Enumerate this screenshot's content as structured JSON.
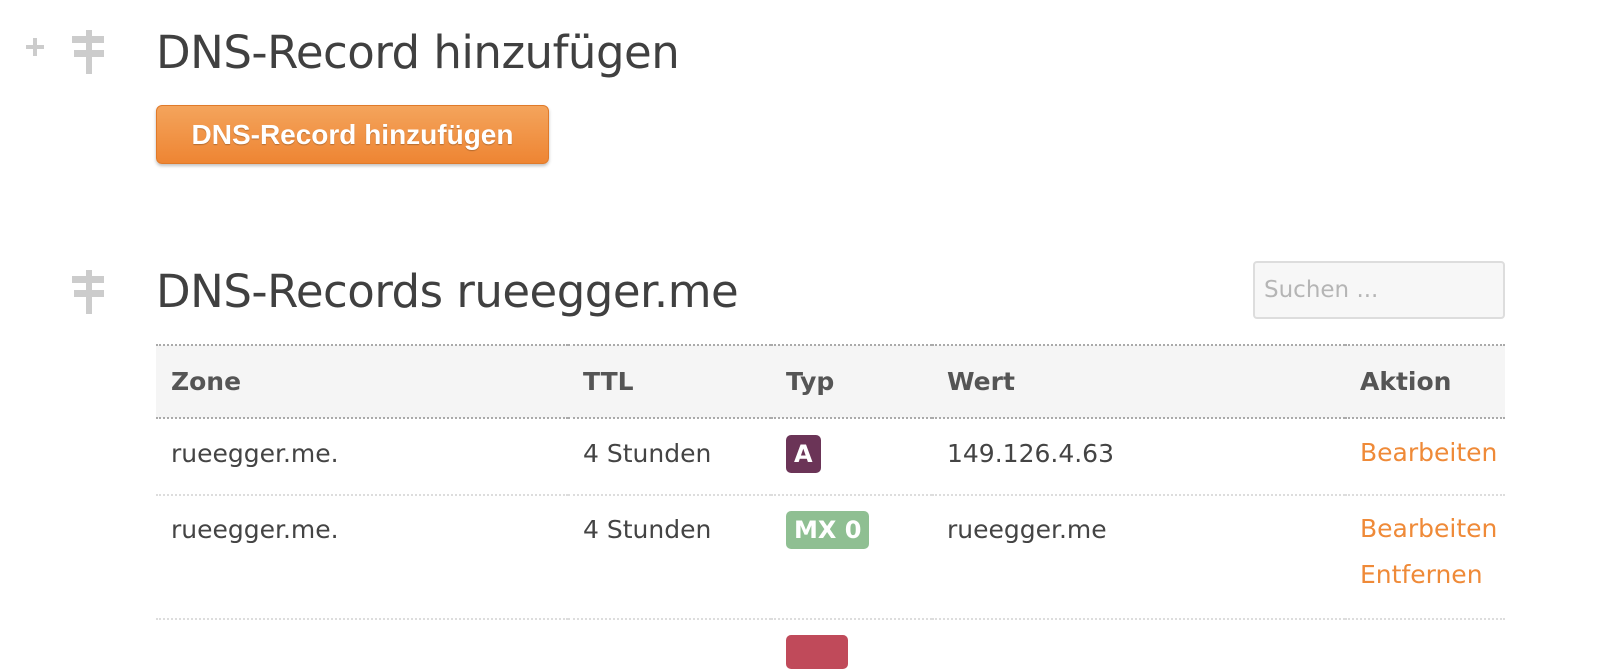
{
  "add_section": {
    "title": "DNS-Record hinzufügen",
    "button_label": "DNS-Record hinzufügen",
    "icons": [
      "plus-icon",
      "signpost-icon"
    ]
  },
  "records_section": {
    "title": "DNS-Records rueegger.me",
    "icon": "signpost-icon",
    "search": {
      "placeholder": "Suchen ...",
      "value": ""
    },
    "columns": [
      "Zone",
      "TTL",
      "Typ",
      "Wert",
      "Aktion"
    ],
    "rows": [
      {
        "zone": "rueegger.me.",
        "ttl": "4 Stunden",
        "type": "A",
        "type_color": "#6b3457",
        "value": "149.126.4.63",
        "actions": [
          "Bearbeiten"
        ]
      },
      {
        "zone": "rueegger.me.",
        "ttl": "4 Stunden",
        "type": "MX 0",
        "type_color": "#8fbf92",
        "value": "rueegger.me",
        "actions": [
          "Bearbeiten",
          "Entfernen"
        ]
      }
    ]
  },
  "colors": {
    "accent": "#ef8a38",
    "button_top": "#f4a45c",
    "button_bottom": "#ee8533",
    "partial_badge": "#c04a5a"
  }
}
